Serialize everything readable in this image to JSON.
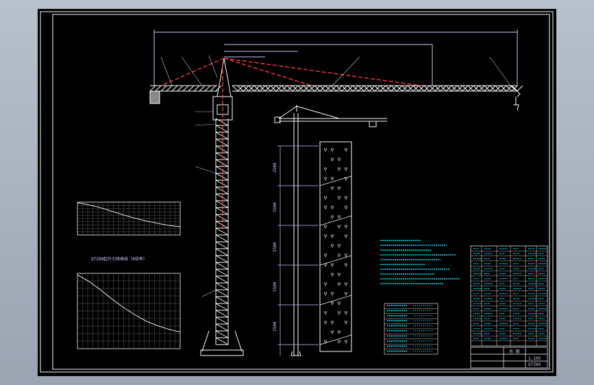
{
  "drawing": {
    "colors": {
      "background": "#000000",
      "frame": "#ffffff",
      "structure": "#ffffff",
      "dimension": "#ff3b3b",
      "annotation": "#00e5ff",
      "text": "#c8c8ff"
    },
    "chart_main_title": "QTZ80起升力矩曲线（4倍率）",
    "tower_height_labels": [
      "2500",
      "2500",
      "2500",
      "2500",
      "2500"
    ],
    "title_block": {
      "drawing_no": "QTZ80",
      "name": "总 图",
      "scale": "1:100"
    }
  },
  "chart_data": [
    {
      "type": "line",
      "title": "",
      "xlabel": "",
      "ylabel": "",
      "series": [
        {
          "values": [
            8,
            7.5,
            6.8,
            5.9,
            5.0,
            4.2,
            3.5,
            2.9,
            2.4,
            2.0
          ]
        }
      ]
    },
    {
      "type": "line",
      "title": "QTZ80起升力矩曲线（4倍率）",
      "xlabel": "",
      "ylabel": "",
      "series": [
        {
          "values": [
            8,
            7.3,
            6.4,
            5.4,
            4.5,
            3.7,
            3.0,
            2.5,
            2.1,
            1.8
          ]
        }
      ]
    }
  ]
}
